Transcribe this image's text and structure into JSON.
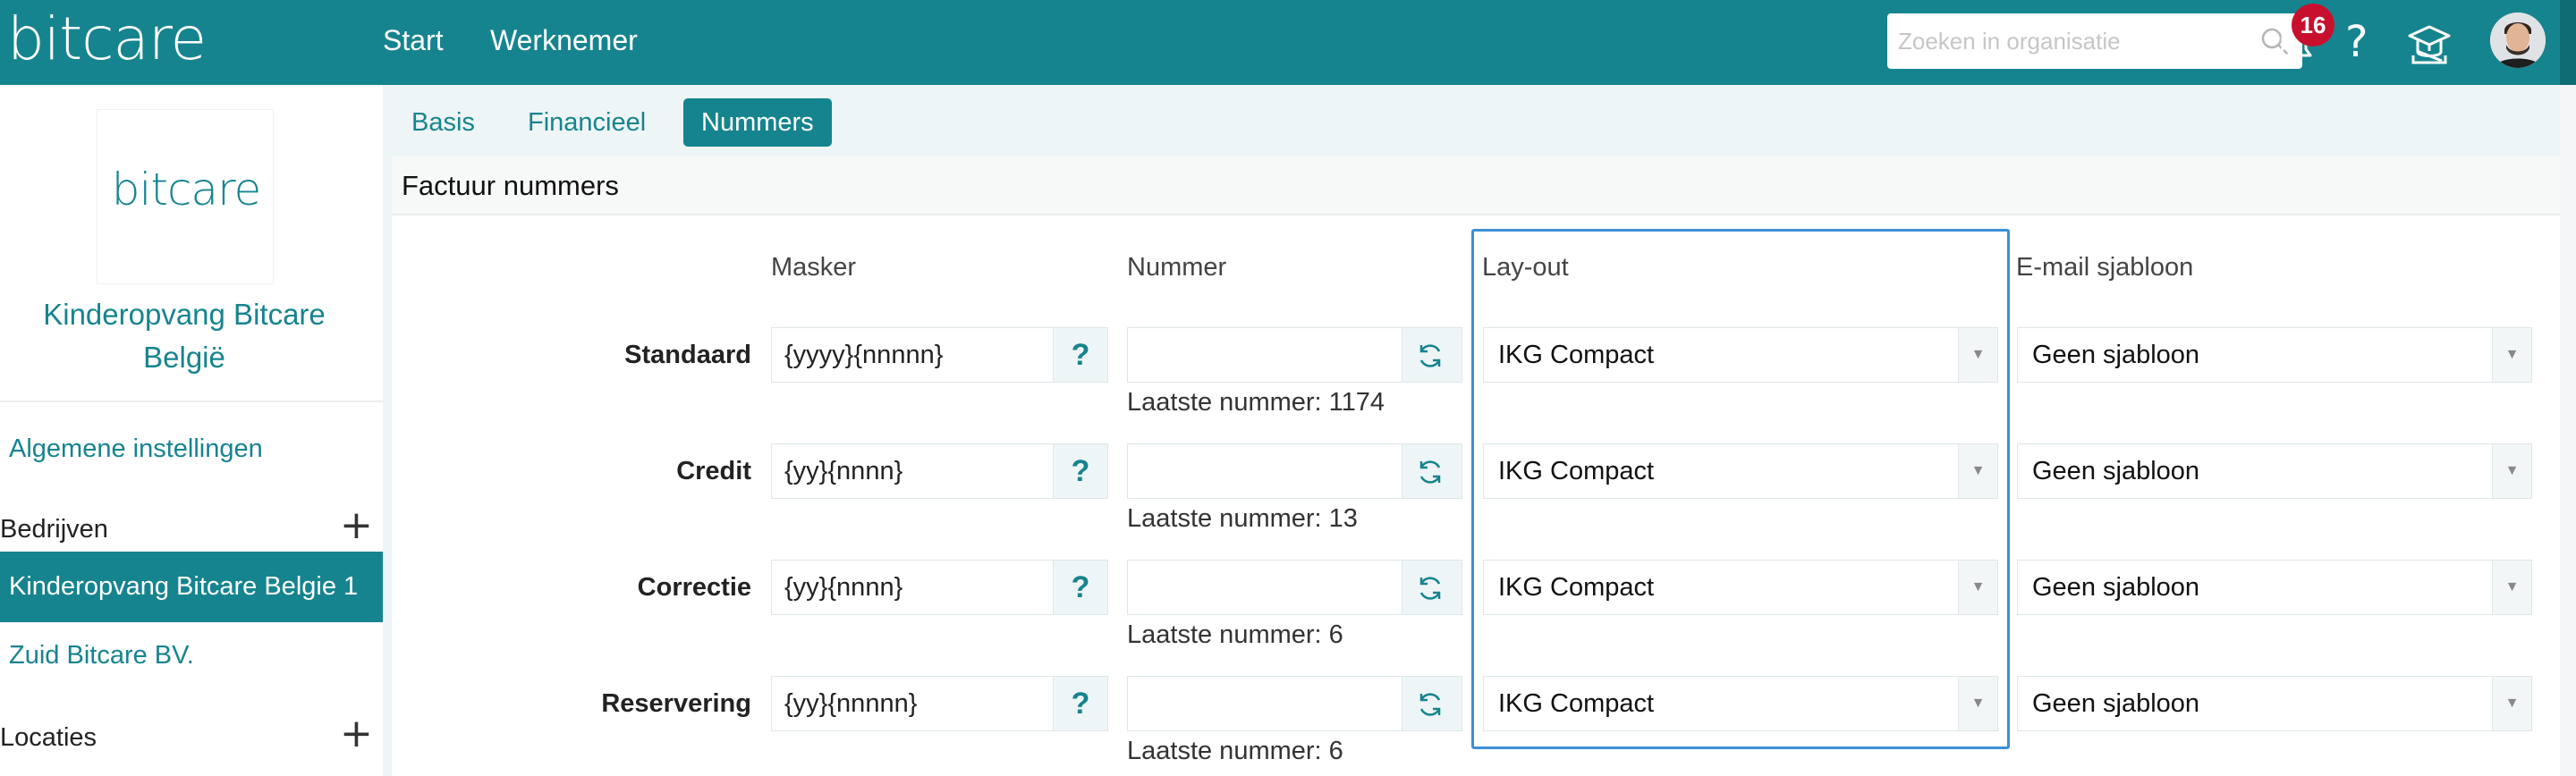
{
  "header": {
    "logo": "bitcare",
    "nav": [
      "Start",
      "Werknemer"
    ],
    "search_placeholder": "Zoeken in organisatie",
    "notification_count": "16",
    "help_label": "?"
  },
  "sidebar": {
    "org_logo": "bitcare",
    "org_name": "Kinderopvang Bitcare België",
    "general_settings": "Algemene instellingen",
    "companies_header": "Bedrijven",
    "add_symbol": "+",
    "companies": [
      "Kinderopvang Bitcare Belgie 1",
      "Zuid Bitcare BV."
    ],
    "locations_header": "Locaties"
  },
  "tabs": [
    "Basis",
    "Financieel",
    "Nummers"
  ],
  "active_tab": "Nummers",
  "section": {
    "title": "Factuur nummers",
    "columns": [
      "Masker",
      "Nummer",
      "Lay-out",
      "E-mail sjabloon"
    ],
    "rows": [
      {
        "label": "Standaard",
        "mask": "{yyyy}{nnnnn}",
        "number": "",
        "last_number": "Laatste nummer: 1174",
        "layout": "IKG Compact",
        "email_template": "Geen sjabloon"
      },
      {
        "label": "Credit",
        "mask": "{yy}{nnnn}",
        "number": "",
        "last_number": "Laatste nummer: 13",
        "layout": "IKG Compact",
        "email_template": "Geen sjabloon"
      },
      {
        "label": "Correctie",
        "mask": "{yy}{nnnn}",
        "number": "",
        "last_number": "Laatste nummer: 6",
        "layout": "IKG Compact",
        "email_template": "Geen sjabloon"
      },
      {
        "label": "Reservering",
        "mask": "{yy}{nnnnn}",
        "number": "",
        "last_number": "Laatste nummer: 6",
        "layout": "IKG Compact",
        "email_template": "Geen sjabloon"
      }
    ],
    "help_symbol": "?"
  },
  "colors": {
    "brand": "#16848f",
    "badge": "#c8102e",
    "highlight": "#3d8fd6"
  },
  "icons": [
    "search-icon",
    "bell-icon",
    "help-icon",
    "graduation-cap-icon",
    "avatar",
    "plus-icon",
    "question-icon",
    "refresh-icon",
    "chevron-down-icon"
  ]
}
